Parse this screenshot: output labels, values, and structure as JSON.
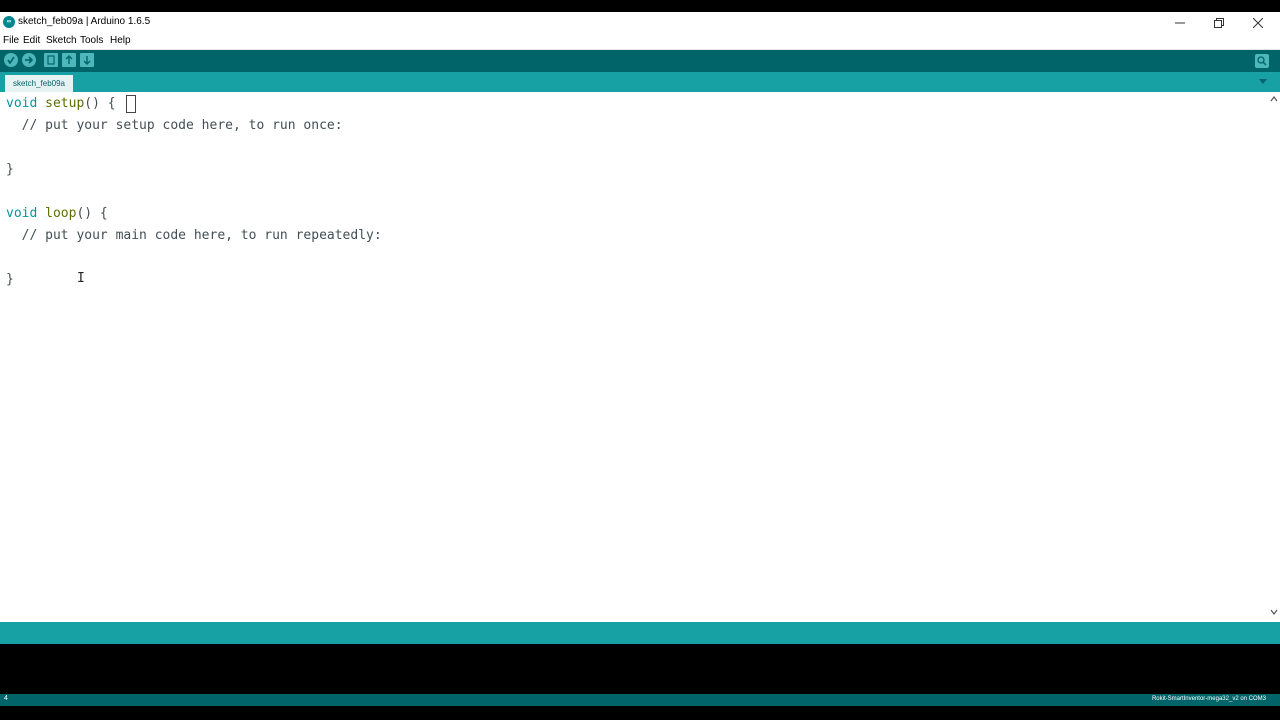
{
  "window": {
    "title": "sketch_feb09a | Arduino 1.6.5",
    "icon_text": "∞"
  },
  "menu": [
    "File",
    "Edit",
    "Sketch",
    "Tools",
    "Help"
  ],
  "toolbar": {
    "buttons": [
      "verify-icon",
      "upload-icon",
      "new-icon",
      "open-icon",
      "save-icon"
    ],
    "serial_monitor": "serial-monitor-icon"
  },
  "tab": {
    "label": "sketch_feb09a"
  },
  "editor": {
    "lines": [
      {
        "type": "void",
        "name": "setup",
        "rest": "() {"
      },
      {
        "comment": "  // put your setup code here, to run once:"
      },
      {
        "text": ""
      },
      {
        "text": "}"
      },
      {
        "text": ""
      },
      {
        "type": "void",
        "name": "loop",
        "rest": "() {"
      },
      {
        "comment": "  // put your main code here, to run repeatedly:"
      },
      {
        "text": ""
      },
      {
        "text": "}"
      }
    ]
  },
  "status": {
    "line_number": "4",
    "board_info": "Rokit-SmartInventor-mega32_v2 on COM3"
  },
  "colors": {
    "toolbar": "#006468",
    "tabbar": "#17a1a5",
    "keyword": "#00979c",
    "function": "#5e6d03"
  }
}
